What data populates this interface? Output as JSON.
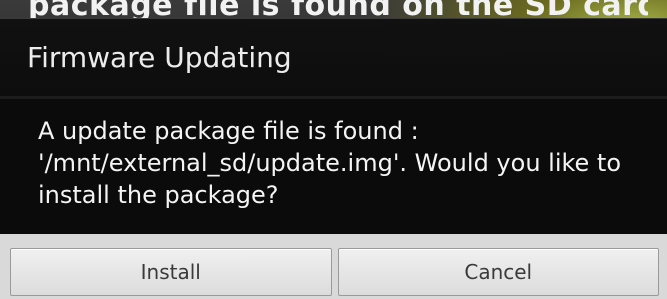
{
  "backdrop": {
    "text": "package file is found on the SD card. Please upgrade"
  },
  "dialog": {
    "title": "Firmware Updating",
    "message": "A update package file is found : '/mnt/external_sd/update.img'. Would you like to install the package?",
    "buttons": {
      "install_label": "Install",
      "cancel_label": "Cancel"
    }
  }
}
